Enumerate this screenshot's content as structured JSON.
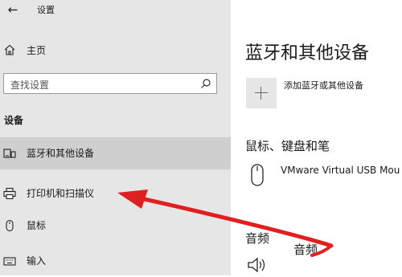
{
  "window": {
    "title": "设置",
    "back_icon": "back-arrow-icon"
  },
  "sidebar": {
    "home_label": "主页",
    "search": {
      "placeholder": "查找设置"
    },
    "section_label": "设备",
    "items": [
      {
        "label": "蓝牙和其他设备",
        "icon": "bluetooth-devices-icon",
        "active": true
      },
      {
        "label": "打印机和扫描仪",
        "icon": "printer-icon",
        "active": false
      },
      {
        "label": "鼠标",
        "icon": "mouse-icon",
        "active": false
      },
      {
        "label": "输入",
        "icon": "keyboard-icon",
        "active": false
      }
    ]
  },
  "main": {
    "title": "蓝牙和其他设备",
    "add_device_label": "添加蓝牙或其他设备",
    "mouse_section": {
      "heading": "鼠标、键盘和笔",
      "device_name": "VMware Virtual USB Mou"
    },
    "audio_section": {
      "heading": "音频",
      "overlay_heading": "音频"
    }
  },
  "annotation": {
    "arrow_color": "#e02020",
    "icon": "red-arrow-annotation"
  },
  "colors": {
    "sidebar_bg": "#e6e6e6",
    "active_bg": "#cfcfcf",
    "main_bg": "#ffffff"
  }
}
